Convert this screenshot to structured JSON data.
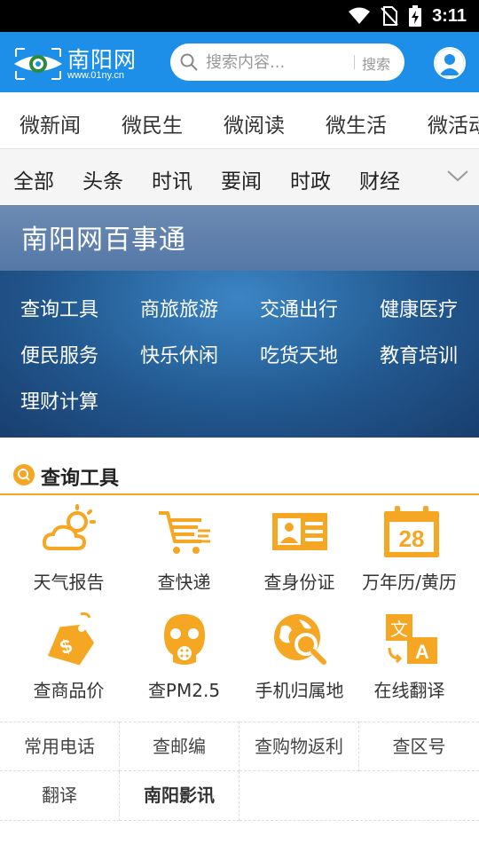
{
  "status_bar": {
    "time": "3:11"
  },
  "header": {
    "logo_name": "南阳网",
    "logo_url": "www.01ny.cn",
    "search_placeholder": "搜索内容...",
    "search_button": "搜索"
  },
  "channel_tabs": [
    "微新闻",
    "微民生",
    "微阅读",
    "微生活",
    "微活动"
  ],
  "category_tabs": [
    "全部",
    "头条",
    "时讯",
    "要闻",
    "时政",
    "财经"
  ],
  "banner": {
    "title": "南阳网百事通",
    "links": [
      "查询工具",
      "商旅旅游",
      "交通出行",
      "健康医疗",
      "便民服务",
      "快乐休闲",
      "吃货天地",
      "教育培训",
      "理财计算"
    ]
  },
  "section": {
    "title": "查询工具"
  },
  "tools": [
    {
      "label": "天气报告",
      "icon": "weather-icon"
    },
    {
      "label": "查快递",
      "icon": "express-icon"
    },
    {
      "label": "查身份证",
      "icon": "id-card-icon"
    },
    {
      "label": "万年历/黄历",
      "icon": "calendar-icon"
    },
    {
      "label": "查商品价",
      "icon": "price-tag-icon"
    },
    {
      "label": "查PM2.5",
      "icon": "gas-mask-icon"
    },
    {
      "label": "手机归属地",
      "icon": "globe-search-icon"
    },
    {
      "label": "在线翻译",
      "icon": "translate-icon"
    }
  ],
  "calendar_day": "28",
  "links": [
    "常用电话",
    "查邮编",
    "查购物返利",
    "查区号",
    "翻译",
    "南阳影讯"
  ],
  "colors": {
    "header_blue": "#1d8fe8",
    "accent_orange": "#f5a623"
  }
}
